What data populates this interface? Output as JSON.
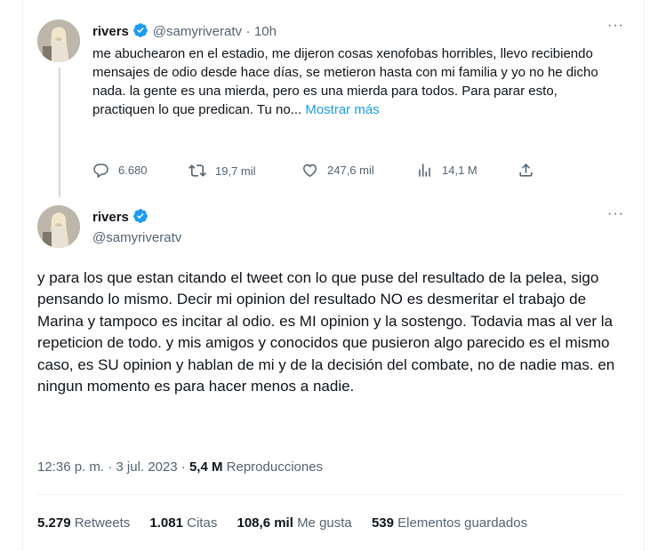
{
  "tweet1": {
    "name": "rivers",
    "handle": "@samyriveratv",
    "separator": "·",
    "time": "10h",
    "more": "···",
    "text": "me abuchearon en el estadio, me dijeron cosas xenofobas horribles, llevo recibiendo mensajes de odio desde hace días, se metieron hasta con mi familia y yo no he dicho nada. la gente es una mierda, pero es una mierda para todos. Para parar esto, practiquen lo que predican. Tu no...",
    "show_more": "Mostrar más",
    "actions": {
      "replies": "6.680",
      "retweets": "19,7 mil",
      "likes": "247,6 mil",
      "views": "14,1 M"
    }
  },
  "tweet2": {
    "name": "rivers",
    "handle": "@samyriveratv",
    "more": "···",
    "text": "y para los que estan citando el tweet con lo que puse del resultado de la pelea, sigo pensando lo mismo. Decir mi opinion del resultado NO es desmeritar el trabajo de Marina y tampoco es incitar al odio. es MI opinion y la sostengo. Todavia mas al ver la repeticion de todo.  y mis amigos y conocidos que pusieron algo parecido es el mismo caso, es SU opinion y hablan de mi y de la decisión del combate, no de nadie mas. en ningun momento es para hacer menos a nadie.",
    "time": "12:36 p. m.",
    "date": "3 jul. 2023",
    "sep": "·",
    "views_count": "5,4 M",
    "views_label": "Reproducciones",
    "stats": {
      "retweets_count": "5.279",
      "retweets_label": "Retweets",
      "quotes_count": "1.081",
      "quotes_label": "Citas",
      "likes_count": "108,6 mil",
      "likes_label": "Me gusta",
      "bookmarks_count": "539",
      "bookmarks_label": "Elementos guardados"
    }
  },
  "colors": {
    "accent": "#1d9bf0",
    "secondary_text": "#536471",
    "primary_text": "#0f1419"
  },
  "icons": [
    "verified-badge-icon",
    "more-icon",
    "reply-icon",
    "retweet-icon",
    "like-icon",
    "views-icon",
    "share-icon"
  ]
}
